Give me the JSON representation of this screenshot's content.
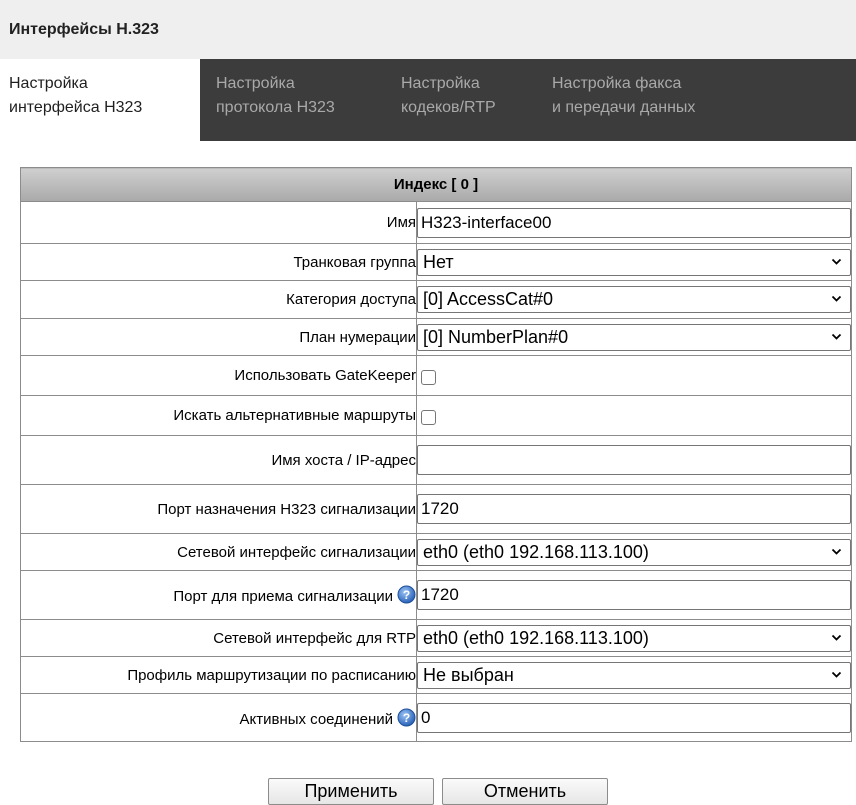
{
  "page": {
    "title": "Интерфейсы H.323"
  },
  "tabs": [
    {
      "line1": "Настройка",
      "line2": "интерфейса H323",
      "active": true
    },
    {
      "line1": "Настройка",
      "line2": "протокола H323",
      "active": false
    },
    {
      "line1": "Настройка",
      "line2": "кодеков/RTP",
      "active": false
    },
    {
      "line1": "Настройка факса",
      "line2": "и передачи данных",
      "active": false
    }
  ],
  "form": {
    "header": "Индекс [ 0 ]",
    "name": {
      "label": "Имя",
      "value": "H323-interface00"
    },
    "trunk_group": {
      "label": "Транковая группа",
      "value": "Нет"
    },
    "access_category": {
      "label": "Категория доступа",
      "value": "[0] AccessCat#0"
    },
    "numbering_plan": {
      "label": "План нумерации",
      "value": "[0] NumberPlan#0"
    },
    "use_gatekeeper": {
      "label": "Использовать GateKeeper",
      "checked": false
    },
    "alt_routes": {
      "label": "Искать альтернативные маршруты",
      "checked": false
    },
    "host": {
      "label": "Имя хоста / IP-адрес",
      "value": ""
    },
    "dest_port": {
      "label": "Порт назначения H323 сигнализации",
      "value": "1720"
    },
    "sig_iface": {
      "label": "Сетевой интерфейс сигнализации",
      "value": "eth0 (eth0 192.168.113.100)"
    },
    "recv_port": {
      "label": "Порт для приема сигнализации",
      "value": "1720",
      "help": true
    },
    "rtp_iface": {
      "label": "Сетевой интерфейс для RTP",
      "value": "eth0 (eth0 192.168.113.100)"
    },
    "schedule_profile": {
      "label": "Профиль маршрутизации по расписанию",
      "value": "Не выбран"
    },
    "active_conns": {
      "label": "Активных соединений",
      "value": "0",
      "help": true
    }
  },
  "buttons": {
    "apply": "Применить",
    "cancel": "Отменить"
  },
  "icons": {
    "select_arrow": "chevron-down-icon",
    "help": "help-icon"
  },
  "colors": {
    "tab_bar": "#3c3c3c",
    "tab_inactive_text": "#a9a9a9",
    "title_bar": "#efefef",
    "help_icon": "#3a7bd5"
  }
}
